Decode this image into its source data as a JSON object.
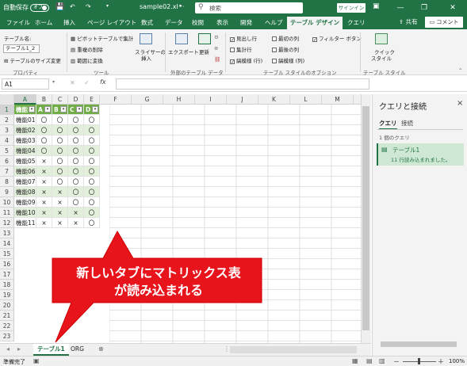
{
  "titlebar": {
    "autosave_label": "自動保存",
    "autosave_state": "オフ",
    "filename": "sample02.xl···",
    "search_placeholder": "検索",
    "signin_label": "サインイン",
    "minimize_glyph": "—",
    "restore_glyph": "❐",
    "close_glyph": "✕",
    "save_glyph": "💾"
  },
  "tabs": [
    "ファイル",
    "ホーム",
    "挿入",
    "ページ レイアウト",
    "数式",
    "データ",
    "校閲",
    "表示",
    "開発",
    "ヘルプ",
    "テーブル デザイン",
    "クエリ"
  ],
  "active_tab_index": 10,
  "share_label": "共有",
  "comment_label": "コメント",
  "ribbon": {
    "table_name_label": "テーブル名:",
    "table_name_value": "テーブル1_2",
    "resize_label": "テーブルのサイズ変更",
    "group_properties": "プロパティ",
    "pivot_label": "ピボットテーブルで集計",
    "remove_dup_label": "重複の削除",
    "convert_range_label": "範囲に変換",
    "group_tools": "ツール",
    "slicer_label_1": "スライサーの",
    "slicer_label_2": "挿入",
    "export_label": "エクスポート",
    "refresh_label": "更新",
    "group_external": "外部のテーブル データ",
    "opt_header_row": "見出し行",
    "opt_total_row": "集計行",
    "opt_banded_rows": "縞模様 (行)",
    "opt_first_col": "最初の列",
    "opt_last_col": "最後の列",
    "opt_banded_cols": "縞模様 (列)",
    "opt_filter_btn": "フィルター ボタン",
    "group_style_opts": "テーブル スタイルのオプション",
    "quick_style_label_1": "クイック",
    "quick_style_label_2": "スタイル",
    "group_styles": "テーブル スタイル",
    "checked_mark": "✓"
  },
  "formula_bar": {
    "name_box": "A1",
    "cancel_glyph": "✕",
    "enter_glyph": "✓",
    "fx_glyph": "fx",
    "formula_value": ""
  },
  "columns": [
    "A",
    "B",
    "C",
    "D",
    "E",
    "F",
    "G",
    "H",
    "I",
    "J",
    "K",
    "L",
    "M"
  ],
  "rows": [
    "1",
    "2",
    "3",
    "4",
    "5",
    "6",
    "7",
    "8",
    "9",
    "10",
    "11",
    "12",
    "13",
    "14",
    "15",
    "16",
    "17",
    "18",
    "19",
    "20",
    "21",
    "22",
    "23"
  ],
  "table": {
    "headers": [
      "機能",
      "A",
      "B",
      "C",
      "D"
    ],
    "dropdown_glyph": "▾",
    "rows": [
      [
        "機能01",
        "〇",
        "〇",
        "〇",
        "〇"
      ],
      [
        "機能02",
        "〇",
        "〇",
        "〇",
        "〇"
      ],
      [
        "機能03",
        "〇",
        "〇",
        "〇",
        "〇"
      ],
      [
        "機能04",
        "〇",
        "〇",
        "〇",
        "〇"
      ],
      [
        "機能05",
        "×",
        "〇",
        "〇",
        "〇"
      ],
      [
        "機能06",
        "×",
        "〇",
        "〇",
        "〇"
      ],
      [
        "機能07",
        "×",
        "〇",
        "〇",
        "〇"
      ],
      [
        "機能08",
        "×",
        "×",
        "〇",
        "〇"
      ],
      [
        "機能09",
        "×",
        "×",
        "〇",
        "〇"
      ],
      [
        "機能10",
        "×",
        "×",
        "×",
        "〇"
      ],
      [
        "機能11",
        "×",
        "×",
        "×",
        "〇"
      ]
    ]
  },
  "sheet_tabs": {
    "tabs": [
      "テーブル1",
      "ORG"
    ],
    "active": 0,
    "add_glyph": "⊕"
  },
  "status": {
    "ready": "準備完了",
    "zoom": "100%",
    "zoom_minus": "－",
    "zoom_plus": "＋"
  },
  "query_pane": {
    "title": "クエリと接続",
    "close_glyph": "×",
    "tab_queries": "クエリ",
    "tab_connections": "接続",
    "query_count": "1 個のクエリ",
    "query_name": "テーブル1",
    "query_status": "11 行読み込まれました。"
  },
  "callout": {
    "line1": "新しいタブにマトリックス表",
    "line2": "が読み込まれる",
    "color": "#e8141c"
  },
  "colors": {
    "excel_green": "#217346",
    "table_header": "#70ad47",
    "table_band": "#e2efda"
  }
}
